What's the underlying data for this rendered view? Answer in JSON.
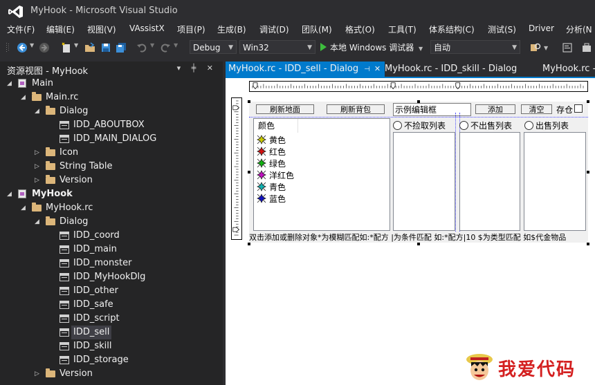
{
  "window": {
    "title": "MyHook - Microsoft Visual Studio"
  },
  "menu": [
    "文件(F)",
    "编辑(E)",
    "视图(V)",
    "VAssistX",
    "项目(P)",
    "生成(B)",
    "调试(D)",
    "团队(M)",
    "格式(O)",
    "工具(T)",
    "体系结构(C)",
    "测试(S)",
    "Driver",
    "分析(N"
  ],
  "toolbar": {
    "config": "Debug",
    "platform": "Win32",
    "run_label": "本地 Windows 调试器",
    "run_mode": "自动"
  },
  "panel": {
    "title": "资源视图 - MyHook",
    "buttons": "▾ ╪ ✕",
    "tree": [
      {
        "label": "Main",
        "expander": "◢",
        "icon": "resource-project-icon",
        "bold": false
      },
      {
        "label": "Main.rc",
        "expander": "◢",
        "icon": "folder-icon"
      },
      {
        "label": "Dialog",
        "expander": "◢",
        "icon": "folder-icon"
      },
      {
        "label": "IDD_ABOUTBOX",
        "expander": "",
        "icon": "dialog-resource-icon"
      },
      {
        "label": "IDD_MAIN_DIALOG",
        "expander": "",
        "icon": "dialog-resource-icon"
      },
      {
        "label": "Icon",
        "expander": "▷",
        "icon": "folder-icon"
      },
      {
        "label": "String Table",
        "expander": "▷",
        "icon": "folder-icon"
      },
      {
        "label": "Version",
        "expander": "▷",
        "icon": "folder-icon"
      },
      {
        "label": "MyHook",
        "expander": "◢",
        "icon": "resource-project-icon",
        "bold": true
      },
      {
        "label": "MyHook.rc",
        "expander": "◢",
        "icon": "folder-icon"
      },
      {
        "label": "Dialog",
        "expander": "◢",
        "icon": "folder-icon"
      },
      {
        "label": "IDD_coord",
        "expander": "",
        "icon": "dialog-resource-icon"
      },
      {
        "label": "IDD_main",
        "expander": "",
        "icon": "dialog-resource-icon"
      },
      {
        "label": "IDD_monster",
        "expander": "",
        "icon": "dialog-resource-icon"
      },
      {
        "label": "IDD_MyHookDlg",
        "expander": "",
        "icon": "dialog-resource-icon"
      },
      {
        "label": "IDD_other",
        "expander": "",
        "icon": "dialog-resource-icon"
      },
      {
        "label": "IDD_safe",
        "expander": "",
        "icon": "dialog-resource-icon"
      },
      {
        "label": "IDD_script",
        "expander": "",
        "icon": "dialog-resource-icon"
      },
      {
        "label": "IDD_sell",
        "expander": "",
        "icon": "dialog-resource-icon",
        "selected": true
      },
      {
        "label": "IDD_skill",
        "expander": "",
        "icon": "dialog-resource-icon"
      },
      {
        "label": "IDD_storage",
        "expander": "",
        "icon": "dialog-resource-icon"
      },
      {
        "label": "Version",
        "expander": "▷",
        "icon": "folder-icon"
      }
    ]
  },
  "tabs": [
    {
      "label": "MyHook.rc - IDD_sell - Dialog",
      "active": true,
      "pin": "⊣",
      "close": "✕"
    },
    {
      "label": "MyHook.rc - IDD_skill - Dialog",
      "active": false
    },
    {
      "label": "MyHook.rc - ",
      "active": false
    }
  ],
  "dialog": {
    "btn_refresh_ground": "刷新地面",
    "btn_refresh_bag": "刷新背包",
    "edit_text": "示例编辑框",
    "btn_add": "添加",
    "btn_clear": "清空",
    "check_label": "存仓",
    "listview_header": "颜色",
    "colors": [
      {
        "name": "黄色",
        "color": "#c8c800"
      },
      {
        "name": "红色",
        "color": "#d01010"
      },
      {
        "name": "绿色",
        "color": "#10b010"
      },
      {
        "name": "洋红色",
        "color": "#c010c0"
      },
      {
        "name": "青色",
        "color": "#10b0b0"
      },
      {
        "name": "蓝色",
        "color": "#1010c0"
      }
    ],
    "radio_no_pick": "不捡取列表",
    "radio_no_sell": "不出售列表",
    "radio_sell": "出售列表",
    "hint": "双击添加或删除对象*为模糊匹配如:*配方 |为条件匹配 如:*配方|10 $为类型匹配 如$代金物品"
  },
  "watermark": {
    "text": "我爱代码"
  },
  "colors": {
    "accent": "#007acc",
    "bg": "#2d2d30",
    "panel": "#252526"
  }
}
